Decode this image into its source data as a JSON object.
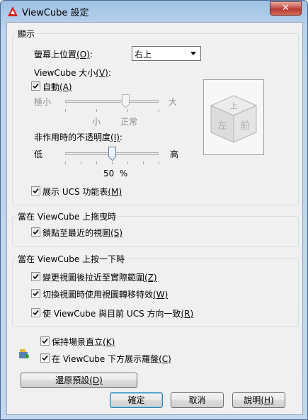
{
  "window": {
    "title": "ViewCube 設定",
    "close_label": "✕"
  },
  "display_group": {
    "title": "顯示",
    "position_label": "螢幕上位置",
    "position_key": "(O)",
    "position_value": "右上",
    "size_label": "ViewCube 大小",
    "size_key": "(V)",
    "auto_label": "自動",
    "auto_key": "(A)",
    "auto_checked": true,
    "size_min": "極小",
    "size_max": "大",
    "size_small": "小",
    "size_normal": "正常",
    "size_level": 0.65,
    "opacity_label": "非作用時的不透明度",
    "opacity_key": "(I)",
    "opacity_low": "低",
    "opacity_high": "高",
    "opacity_value": "50",
    "opacity_unit": "%",
    "opacity_level": 0.5,
    "ucs_menu_label": "展示 UCS 功能表",
    "ucs_menu_key": "(M)",
    "ucs_menu_checked": true,
    "cube_faces": {
      "top": "上",
      "left": "左",
      "front": "前"
    }
  },
  "drag_group": {
    "title": "當在 ViewCube 上拖曳時",
    "snap_label": "鎖點至最近的視圖",
    "snap_key": "(S)",
    "snap_checked": true
  },
  "click_group": {
    "title": "當在 ViewCube 上按一下時",
    "zoom_label": "變更視圖後拉近至實際範圍",
    "zoom_key": "(Z)",
    "zoom_checked": true,
    "transition_label": "切換視圖時使用視圖轉移特效",
    "transition_key": "(W)",
    "transition_checked": true,
    "orient_label": "使 ViewCube 與目前 UCS 方向一致",
    "orient_key": "(R)",
    "orient_checked": true
  },
  "upright_label": "保持場景直立",
  "upright_key": "(K)",
  "upright_checked": true,
  "compass_label": "在 ViewCube 下方展示羅盤",
  "compass_key": "(C)",
  "compass_checked": true,
  "restore_label": "還原預設",
  "restore_key": "(D)",
  "buttons": {
    "ok": "確定",
    "cancel": "取消",
    "help": "說明",
    "help_key": "(H)"
  }
}
